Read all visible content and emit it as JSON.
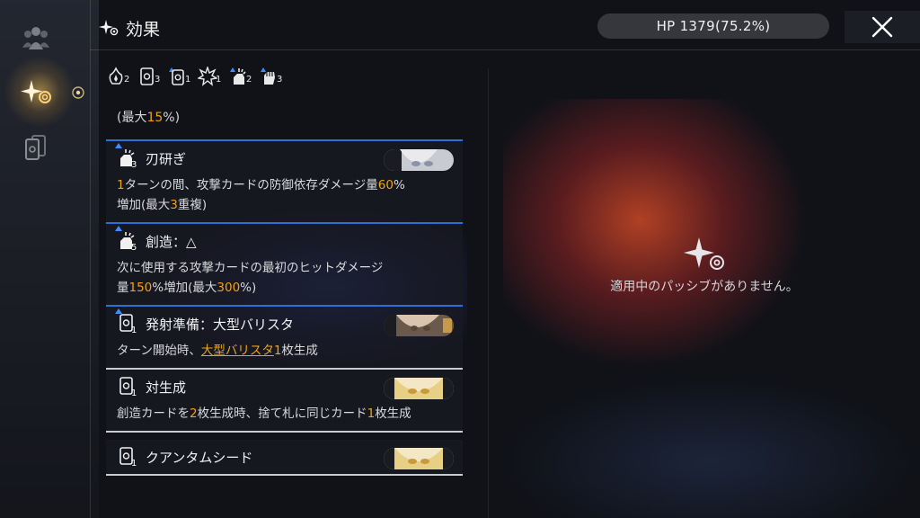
{
  "header": {
    "title": "効果",
    "hp_text": "HP 1379(75.2%)"
  },
  "rail": {
    "items": [
      {
        "icon": "party-icon",
        "active": false
      },
      {
        "icon": "effect-sparkle-icon",
        "active": true
      },
      {
        "icon": "card-deck-icon",
        "active": false
      }
    ]
  },
  "summary": {
    "items": [
      {
        "icon": "flame-icon",
        "count": "2"
      },
      {
        "icon": "card-icon",
        "count": "3"
      },
      {
        "icon": "card-up-icon",
        "count": "1"
      },
      {
        "icon": "burst-icon",
        "count": "1"
      },
      {
        "icon": "sharpen-icon",
        "count": "2"
      },
      {
        "icon": "fist-up-icon",
        "count": "3"
      }
    ]
  },
  "cut_card": {
    "prefix": "(最大",
    "value": "15",
    "suffix": "%)"
  },
  "cards": [
    {
      "name": "刃研ぎ",
      "level": "3",
      "icon": "sharpen-icon",
      "portrait": "silver-hair-character",
      "desc": [
        [
          {
            "t": "1",
            "h": true
          },
          {
            "t": "ターンの間、攻撃カードの防御依存ダメージ量",
            "h": false
          },
          {
            "t": "60",
            "h": true
          },
          {
            "t": "%",
            "h": false
          }
        ],
        [
          {
            "t": "増加(最大",
            "h": false
          },
          {
            "t": "3",
            "h": true
          },
          {
            "t": "重複)",
            "h": false
          }
        ]
      ]
    },
    {
      "name": "創造：△",
      "level": "5",
      "icon": "sharpen-icon",
      "portrait": "",
      "desc": [
        [
          {
            "t": "次に使用する攻撃カードの最初のヒットダメージ",
            "h": false
          }
        ],
        [
          {
            "t": "量",
            "h": false
          },
          {
            "t": "150",
            "h": true
          },
          {
            "t": "%増加(最大",
            "h": false
          },
          {
            "t": "300",
            "h": true
          },
          {
            "t": "%)",
            "h": false
          }
        ]
      ]
    },
    {
      "name": "発射準備：大型バリスタ",
      "level": "1",
      "icon": "card-icon",
      "portrait": "brown-hair-character",
      "desc_prefix": "ターン開始時、",
      "desc_link": "大型バリスタ",
      "desc_suffix_num": "1",
      "desc_suffix": "枚生成"
    },
    {
      "name": "対生成",
      "level": "1",
      "icon": "card-icon",
      "portrait": "blonde-character",
      "desc": [
        [
          {
            "t": "創造カードを",
            "h": false
          },
          {
            "t": "2",
            "h": true
          },
          {
            "t": "枚生成時、捨て札に同じカード",
            "h": false
          },
          {
            "t": "1",
            "h": true
          },
          {
            "t": "枚生成",
            "h": false
          }
        ]
      ]
    },
    {
      "name": "クアンタムシード",
      "level": "1",
      "icon": "card-icon",
      "portrait": "blonde-character"
    }
  ],
  "empty_state": {
    "text": "適用中のパッシブがありません。"
  },
  "colors": {
    "accent_orange": "#f0a21a",
    "divider_blue": "#2e6fd6",
    "divider_white": "#c9cbd2"
  }
}
